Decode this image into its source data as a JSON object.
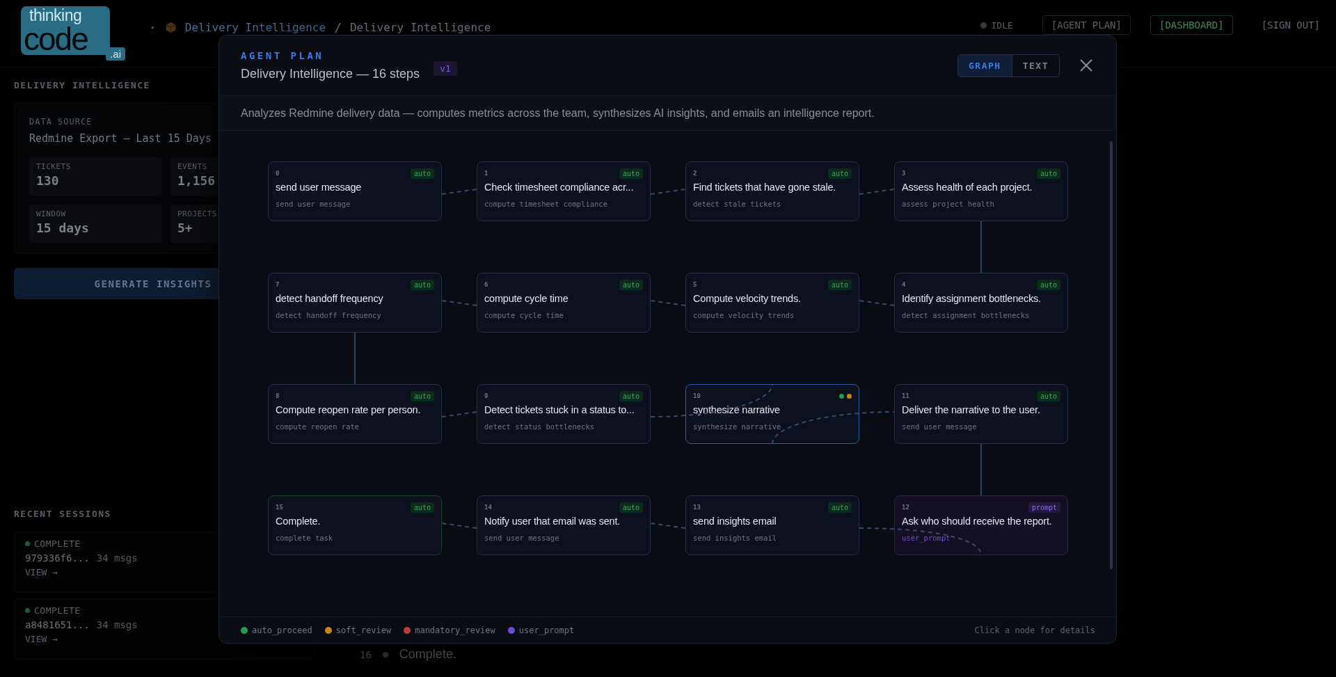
{
  "topbar": {
    "logo": {
      "top": "thinking",
      "main": "code",
      "suffix": ".ai"
    },
    "breadcrumb": {
      "lead": "·",
      "separator": "/",
      "items": [
        {
          "label": "Delivery Intelligence",
          "link": true
        },
        {
          "label": "Delivery Intelligence",
          "link": false
        }
      ]
    },
    "status": {
      "label": "IDLE"
    },
    "nav": [
      {
        "label": "[AGENT PLAN]",
        "kind": "outline"
      },
      {
        "label": "[DASHBOARD]",
        "kind": "accent"
      },
      {
        "label": "[SIGN OUT]",
        "kind": "ghost"
      }
    ]
  },
  "sidebar": {
    "title": "DELIVERY INTELLIGENCE",
    "source_label": "DATA SOURCE",
    "source_value": "Redmine Export — Last 15 Days",
    "stats": [
      {
        "label": "TICKETS",
        "value": "130"
      },
      {
        "label": "EVENTS",
        "value": "1,156"
      },
      {
        "label": "WINDOW",
        "value": "15 days"
      },
      {
        "label": "PROJECTS",
        "value": "5+"
      }
    ],
    "button": "GENERATE INSIGHTS",
    "sessions_title": "RECENT SESSIONS",
    "sessions": [
      {
        "status": "COMPLETE",
        "id": "979336f6...",
        "count": "34 msgs",
        "link": "VIEW →"
      },
      {
        "status": "COMPLETE",
        "id": "a8481651...",
        "count": "34 msgs",
        "link": "VIEW →"
      }
    ]
  },
  "main": {
    "steps": [
      {
        "index": "16",
        "label": "Complete."
      }
    ]
  },
  "modal": {
    "eyebrow": "AGENT PLAN",
    "title": "Delivery Intelligence — 16 steps",
    "version": "v1",
    "views": [
      {
        "label": "GRAPH",
        "selected": true
      },
      {
        "label": "TEXT",
        "selected": false
      }
    ],
    "description": "Analyzes Redmine delivery data — computes metrics across the team, synthesizes AI insights, and emails an intelligence report.",
    "nodes": [
      {
        "index": "0",
        "title": "send user message",
        "subtitle": "send user message",
        "kind": "auto",
        "badge": "auto",
        "selected": false
      },
      {
        "index": "1",
        "title": "Check timesheet compliance acr...",
        "subtitle": "compute timesheet compliance",
        "kind": "auto",
        "badge": "auto",
        "selected": false
      },
      {
        "index": "2",
        "title": "Find tickets that have gone stale.",
        "subtitle": "detect stale tickets",
        "kind": "auto",
        "badge": "auto",
        "selected": false
      },
      {
        "index": "3",
        "title": "Assess health of each project.",
        "subtitle": "assess project health",
        "kind": "auto",
        "badge": "auto",
        "selected": false
      },
      {
        "index": "7",
        "title": "detect handoff frequency",
        "subtitle": "detect handoff frequency",
        "kind": "auto",
        "badge": "auto",
        "selected": false
      },
      {
        "index": "6",
        "title": "compute cycle time",
        "subtitle": "compute cycle time",
        "kind": "auto",
        "badge": "auto",
        "selected": false
      },
      {
        "index": "5",
        "title": "Compute velocity trends.",
        "subtitle": "compute velocity trends",
        "kind": "auto",
        "badge": "auto",
        "selected": false
      },
      {
        "index": "4",
        "title": "Identify assignment bottlenecks.",
        "subtitle": "detect assignment bottlenecks",
        "kind": "auto",
        "badge": "auto",
        "selected": false
      },
      {
        "index": "8",
        "title": "Compute reopen rate per person.",
        "subtitle": "compute reopen rate",
        "kind": "auto",
        "badge": "auto",
        "selected": false
      },
      {
        "index": "9",
        "title": "Detect tickets stuck in a status to...",
        "subtitle": "detect status bottlenecks",
        "kind": "auto",
        "badge": "auto",
        "selected": false
      },
      {
        "index": "10",
        "title": "synthesize narrative",
        "subtitle": "synthesize narrative",
        "kind": "review",
        "dots": [
          {
            "color": "#1f9d55"
          },
          {
            "color": "#c9860f"
          }
        ],
        "selected": true
      },
      {
        "index": "11",
        "title": "Deliver the narrative to the user.",
        "subtitle": "send user message",
        "kind": "auto",
        "badge": "auto",
        "selected": false
      },
      {
        "index": "15",
        "title": "Complete.",
        "subtitle": "complete task",
        "kind": "end",
        "badge": "auto",
        "selected": false
      },
      {
        "index": "14",
        "title": "Notify user that email was sent.",
        "subtitle": "send user message",
        "kind": "auto",
        "badge": "auto",
        "selected": false
      },
      {
        "index": "13",
        "title": "send insights email",
        "subtitle": "send insights email",
        "kind": "auto",
        "badge": "auto",
        "selected": false
      },
      {
        "index": "12",
        "title": "Ask who should receive the report.",
        "subtitle": "user_prompt",
        "kind": "prompt",
        "badge": "prompt",
        "selected": false
      }
    ],
    "legend": [
      {
        "label": "auto_proceed",
        "color": "#1f9d55"
      },
      {
        "label": "soft_review",
        "color": "#c9860f"
      },
      {
        "label": "mandatory_review",
        "color": "#c23b3b"
      },
      {
        "label": "user_prompt",
        "color": "#6c4fd6"
      }
    ],
    "hint": "Click a node for details"
  }
}
